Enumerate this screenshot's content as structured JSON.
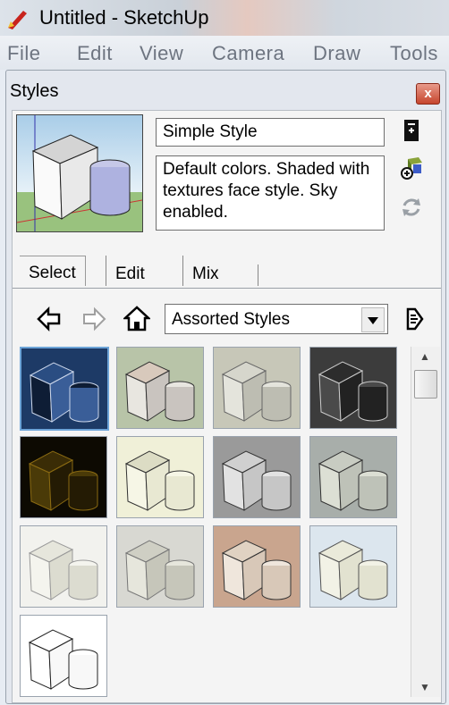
{
  "window": {
    "title": "Untitled - SketchUp"
  },
  "menubar": {
    "items": [
      "File",
      "Edit",
      "View",
      "Camera",
      "Draw",
      "Tools"
    ]
  },
  "panel": {
    "title": "Styles",
    "close_label": "x",
    "style_name": "Simple Style",
    "style_description": "Default colors.  Shaded with textures face style.  Sky enabled.",
    "side_icons": [
      "create-new-style-icon",
      "update-style-icon",
      "refresh-icon"
    ],
    "tabs": [
      "Select",
      "Edit",
      "Mix"
    ],
    "active_tab": "Select",
    "nav": {
      "collection_selected": "Assorted Styles"
    },
    "style_count": 13,
    "selected_index": 0
  },
  "colors": {
    "accent": "#6da4d8",
    "close": "#c6452d"
  }
}
